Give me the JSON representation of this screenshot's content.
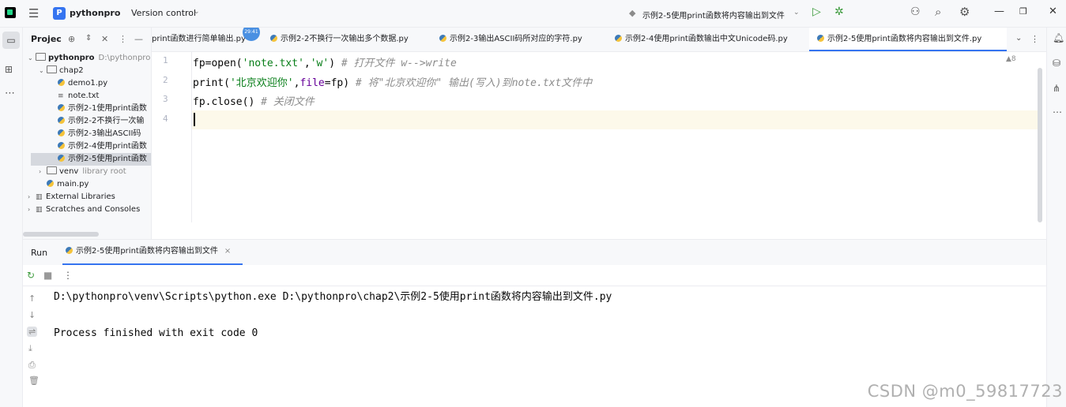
{
  "titlebar": {
    "project_badge": "P",
    "project_name": "pythonpro",
    "vcs": "Version control",
    "run_config": "示例2-5使用print函数将内容输出到文件"
  },
  "project_panel": {
    "title": "Projec",
    "tree": [
      {
        "label": "pythonpro",
        "hint": "D:\\pythonpro",
        "type": "folder",
        "depth": 0,
        "expanded": true
      },
      {
        "label": "chap2",
        "type": "folder",
        "depth": 1,
        "expanded": true
      },
      {
        "label": "demo1.py",
        "type": "py",
        "depth": 2
      },
      {
        "label": "note.txt",
        "type": "txt",
        "depth": 2
      },
      {
        "label": "示例2-1使用print函数",
        "type": "py",
        "depth": 2
      },
      {
        "label": "示例2-2不换行一次输",
        "type": "py",
        "depth": 2
      },
      {
        "label": "示例2-3输出ASCII码",
        "type": "py",
        "depth": 2
      },
      {
        "label": "示例2-4使用print函数",
        "type": "py",
        "depth": 2
      },
      {
        "label": "示例2-5使用print函数",
        "type": "py",
        "depth": 2,
        "selected": true
      },
      {
        "label": "venv",
        "hint": "library root",
        "type": "folder",
        "depth": 1,
        "expanded": false
      },
      {
        "label": "main.py",
        "type": "py",
        "depth": 1
      },
      {
        "label": "External Libraries",
        "type": "lib",
        "depth": 0,
        "expanded": false
      },
      {
        "label": "Scratches and Consoles",
        "type": "lib",
        "depth": 0,
        "expanded": false
      }
    ]
  },
  "tabs": [
    {
      "label": "print函数进行简单输出.py",
      "active": false
    },
    {
      "label": "示例2-2不换行一次输出多个数据.py",
      "active": false
    },
    {
      "label": "示例2-3输出ASCII码所对应的字符.py",
      "active": false
    },
    {
      "label": "示例2-4使用print函数输出中文Unicode码.py",
      "active": false
    },
    {
      "label": "示例2-5使用print函数将内容输出到文件.py",
      "active": true
    }
  ],
  "tab_time": "29:41",
  "editor": {
    "line_numbers": [
      "1",
      "2",
      "3",
      "4"
    ],
    "lines": [
      {
        "code": "fp=open(",
        "s1": "'note.txt'",
        "sep": ",",
        "s2": "'w'",
        "end": ") ",
        "comment": "# 打开文件 w-->write"
      },
      {
        "code": "print(",
        "s1": "'北京欢迎你'",
        "sep": ",",
        "kw": "file",
        "end": "=fp) ",
        "comment": "# 将\"北京欢迎你\" 输出(写入)到note.txt文件中"
      },
      {
        "code": "fp.close() ",
        "comment": "# 关闭文件"
      }
    ],
    "status": "▲8"
  },
  "run": {
    "title": "Run",
    "tab_label": "示例2-5使用print函数将内容输出到文件",
    "output": [
      "D:\\pythonpro\\venv\\Scripts\\python.exe D:\\pythonpro\\chap2\\示例2-5使用print函数将内容输出到文件.py",
      "",
      "Process finished with exit code 0"
    ]
  },
  "watermark": "CSDN @m0_59817723"
}
